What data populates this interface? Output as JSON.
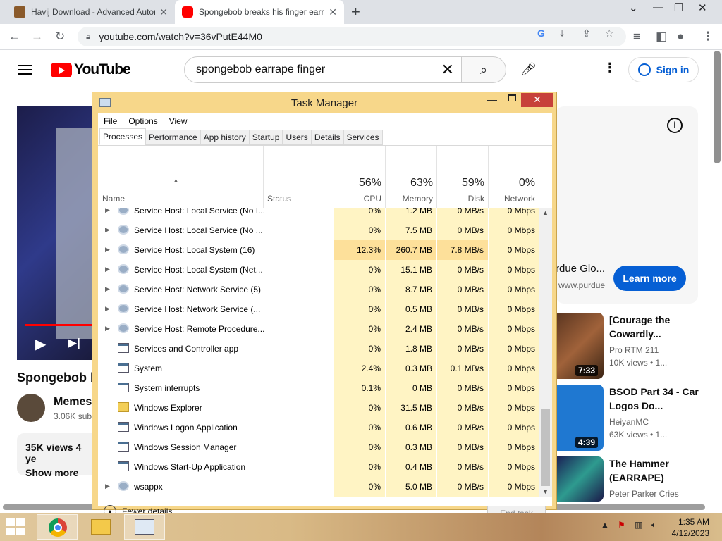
{
  "browser": {
    "tabs": [
      {
        "title": "Havij Download - Advanced Autom",
        "close": "✕"
      },
      {
        "title": "Spongebob breaks his finger earrape",
        "close": "✕"
      }
    ],
    "new_tab": "+",
    "url": "youtube.com/watch?v=36vPutE44M0"
  },
  "youtube": {
    "logo_text": "YouTube",
    "search_query": "spongebob earrape finger",
    "sign_in": "Sign in",
    "video_title": "Spongebob b",
    "channel_name": "Memes",
    "channel_subs": "3.06K sub",
    "views": "35K views  4 ye",
    "show_more": "Show more",
    "ad": {
      "title": "rdue Glo...",
      "url": "www.purdue",
      "button": "Learn more",
      "info": "i"
    },
    "recommendations": [
      {
        "title": "[Courage the Cowardly...",
        "channel": "Pro RTM 211",
        "meta": "10K views • 1...",
        "duration": "7:33",
        "color": "#7a4a2a"
      },
      {
        "title": "BSOD Part 34 - Car Logos Do...",
        "channel": "HeiyanMC",
        "meta": "63K views • 1...",
        "duration": "4:39",
        "color": "#1f78d1"
      },
      {
        "title": "The Hammer (EARRAPE)",
        "channel": "Peter Parker Cries",
        "meta": "",
        "duration": "",
        "color": "#2a2f6e"
      }
    ]
  },
  "taskmanager": {
    "title": "Task Manager",
    "menu": [
      "File",
      "Options",
      "View"
    ],
    "tabs": [
      "Processes",
      "Performance",
      "App history",
      "Startup",
      "Users",
      "Details",
      "Services"
    ],
    "columns": {
      "name": "Name",
      "status": "Status",
      "cpu": {
        "pct": "56%",
        "label": "CPU"
      },
      "memory": {
        "pct": "63%",
        "label": "Memory"
      },
      "disk": {
        "pct": "59%",
        "label": "Disk"
      },
      "network": {
        "pct": "0%",
        "label": "Network"
      }
    },
    "rows": [
      {
        "name": "Service Host: Local Service (No I...",
        "icon": "svc",
        "exp": true,
        "cpu": "0%",
        "mem": "1.2 MB",
        "disk": "0 MB/s",
        "net": "0 Mbps"
      },
      {
        "name": "Service Host: Local Service (No ...",
        "icon": "svc",
        "exp": true,
        "cpu": "0%",
        "mem": "7.5 MB",
        "disk": "0 MB/s",
        "net": "0 Mbps"
      },
      {
        "name": "Service Host: Local System (16)",
        "icon": "svc",
        "exp": true,
        "cpu": "12.3%",
        "mem": "260.7 MB",
        "disk": "7.8 MB/s",
        "net": "0 Mbps",
        "hot": true
      },
      {
        "name": "Service Host: Local System (Net...",
        "icon": "svc",
        "exp": true,
        "cpu": "0%",
        "mem": "15.1 MB",
        "disk": "0 MB/s",
        "net": "0 Mbps"
      },
      {
        "name": "Service Host: Network Service (5)",
        "icon": "svc",
        "exp": true,
        "cpu": "0%",
        "mem": "8.7 MB",
        "disk": "0 MB/s",
        "net": "0 Mbps"
      },
      {
        "name": "Service Host: Network Service (...",
        "icon": "svc",
        "exp": true,
        "cpu": "0%",
        "mem": "0.5 MB",
        "disk": "0 MB/s",
        "net": "0 Mbps"
      },
      {
        "name": "Service Host: Remote Procedure...",
        "icon": "svc",
        "exp": true,
        "cpu": "0%",
        "mem": "2.4 MB",
        "disk": "0 MB/s",
        "net": "0 Mbps"
      },
      {
        "name": "Services and Controller app",
        "icon": "app",
        "exp": false,
        "cpu": "0%",
        "mem": "1.8 MB",
        "disk": "0 MB/s",
        "net": "0 Mbps"
      },
      {
        "name": "System",
        "icon": "app",
        "exp": false,
        "cpu": "2.4%",
        "mem": "0.3 MB",
        "disk": "0.1 MB/s",
        "net": "0 Mbps"
      },
      {
        "name": "System interrupts",
        "icon": "app",
        "exp": false,
        "cpu": "0.1%",
        "mem": "0 MB",
        "disk": "0 MB/s",
        "net": "0 Mbps"
      },
      {
        "name": "Windows Explorer",
        "icon": "fld",
        "exp": false,
        "cpu": "0%",
        "mem": "31.5 MB",
        "disk": "0 MB/s",
        "net": "0 Mbps"
      },
      {
        "name": "Windows Logon Application",
        "icon": "app",
        "exp": false,
        "cpu": "0%",
        "mem": "0.6 MB",
        "disk": "0 MB/s",
        "net": "0 Mbps"
      },
      {
        "name": "Windows Session Manager",
        "icon": "app",
        "exp": false,
        "cpu": "0%",
        "mem": "0.3 MB",
        "disk": "0 MB/s",
        "net": "0 Mbps"
      },
      {
        "name": "Windows Start-Up Application",
        "icon": "app",
        "exp": false,
        "cpu": "0%",
        "mem": "0.4 MB",
        "disk": "0 MB/s",
        "net": "0 Mbps"
      },
      {
        "name": "wsappx",
        "icon": "svc",
        "exp": true,
        "cpu": "0%",
        "mem": "5.0 MB",
        "disk": "0 MB/s",
        "net": "0 Mbps"
      }
    ],
    "fewer_details": "Fewer details",
    "end_task": "End task"
  },
  "taskbar": {
    "time": "1:35 AM",
    "date": "4/12/2023"
  }
}
